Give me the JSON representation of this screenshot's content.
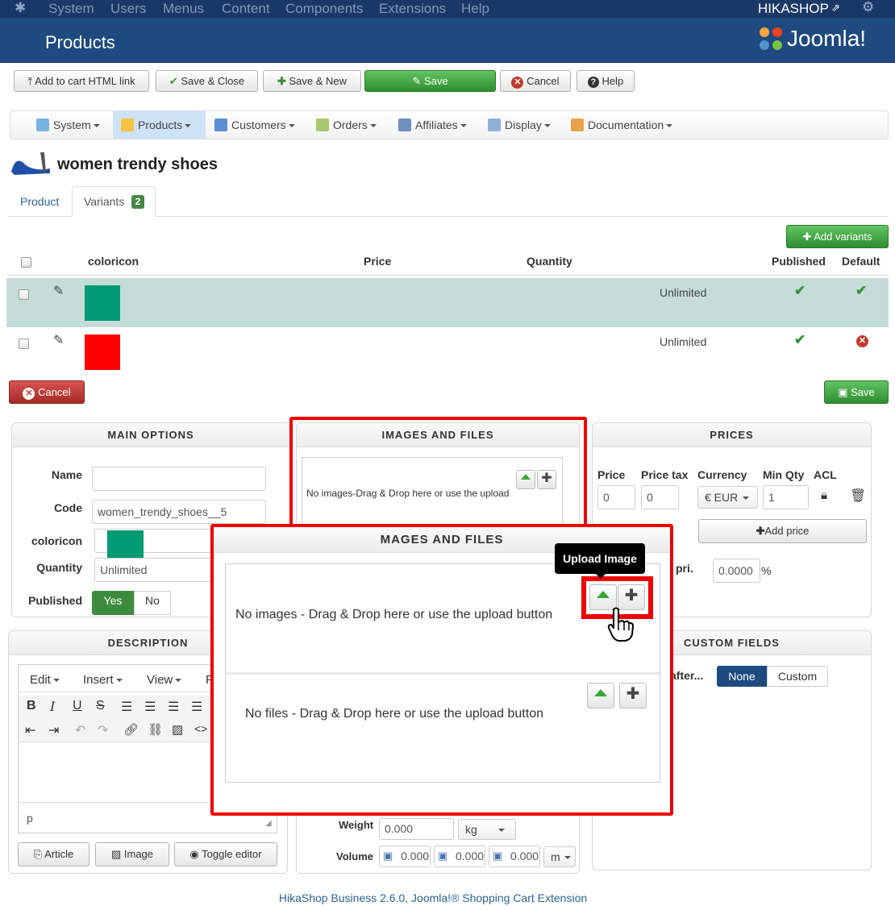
{
  "topbar": {
    "menu": [
      "System",
      "Users",
      "Menus",
      "Content",
      "Components",
      "Extensions",
      "Help"
    ],
    "site": "HIKASHOP"
  },
  "header": {
    "title": "Products",
    "brand": "Joomla!"
  },
  "toolbar": {
    "add_to_cart": "Add to cart HTML link",
    "save_close": "Save & Close",
    "save_new": "Save & New",
    "save": "Save",
    "cancel": "Cancel",
    "help": "Help"
  },
  "hikamenu": [
    "System",
    "Products",
    "Customers",
    "Orders",
    "Affiliates",
    "Display",
    "Documentation"
  ],
  "product": {
    "title": "women trendy shoes"
  },
  "tabs": {
    "product": "Product",
    "variants": "Variants",
    "variants_count": "2"
  },
  "variants": {
    "add_button": "Add variants",
    "columns": {
      "name": "coloricon",
      "price": "Price",
      "quantity": "Quantity",
      "published": "Published",
      "default": "Default"
    },
    "rows": [
      {
        "color": "#009a73",
        "quantity": "Unlimited"
      },
      {
        "color": "#ff0000",
        "quantity": "Unlimited"
      }
    ],
    "cancel": "Cancel",
    "save": "Save"
  },
  "main_options": {
    "title": "MAIN OPTIONS",
    "name_label": "Name",
    "name_value": "",
    "code_label": "Code",
    "code_value": "women_trendy_shoes__5",
    "coloricon_label": "coloricon",
    "coloricon_color": "#009a73",
    "quantity_label": "Quantity",
    "quantity_value": "Unlimited",
    "published_label": "Published",
    "yes": "Yes",
    "no": "No"
  },
  "images_back": {
    "title": "IMAGES AND FILES",
    "no_images": "No images-Drag & Drop here or use the upload"
  },
  "prices": {
    "title": "PRICES",
    "price_label": "Price",
    "price_tax_label": "Price tax",
    "currency_label": "Currency",
    "min_qty_label": "Min Qty",
    "acl_label": "ACL",
    "price_value": "0",
    "price_tax_value": "0",
    "currency_value": "€ EUR",
    "min_qty_value": "1",
    "add_price": "Add price",
    "pri_label": "pri.",
    "pct_value": "0.0000",
    "pct_unit": "%"
  },
  "description": {
    "title": "DESCRIPTION",
    "edit": "Edit",
    "insert": "Insert",
    "view": "View",
    "f": "F",
    "paragraph": "p",
    "article": "Article",
    "image": "Image",
    "toggle": "Toggle editor"
  },
  "custom_fields": {
    "title": "CUSTOM FIELDS",
    "after_label": "after...",
    "none": "None",
    "custom": "Custom"
  },
  "dims": {
    "weight_label": "Weight",
    "weight_value": "0.000",
    "weight_unit": "kg",
    "volume_label": "Volume",
    "v1": "0.000",
    "v2": "0.000",
    "v3": "0.000",
    "volume_unit": "m"
  },
  "zoom": {
    "title": "MAGES AND FILES",
    "tooltip": "Upload Image",
    "no_images": "No images - Drag & Drop here or use the upload button",
    "no_files": "No files - Drag & Drop here or use the upload button"
  },
  "footer": "HikaShop Business 2.6.0, Joomla!® Shopping Cart Extension"
}
